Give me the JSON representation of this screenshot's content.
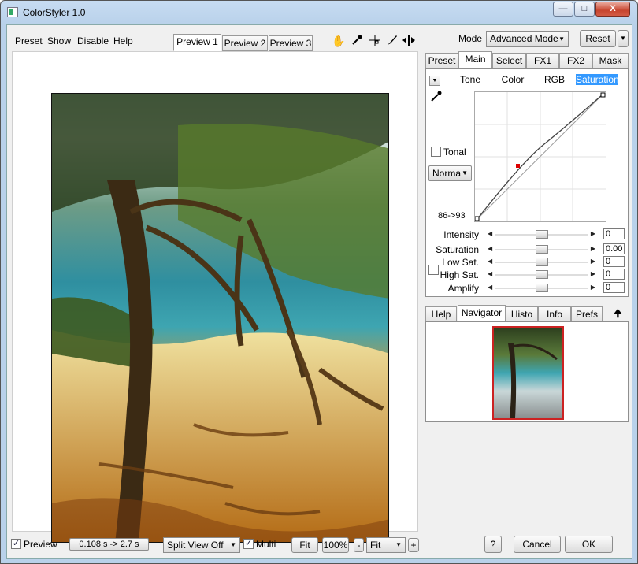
{
  "window": {
    "title": "ColorStyler 1.0",
    "min": "—",
    "max": "□",
    "close": "X"
  },
  "menu": [
    "Preset",
    "Show",
    "Disable",
    "Help"
  ],
  "preview_tabs": [
    {
      "label": "Preview 1",
      "active": true
    },
    {
      "label": "Preview 2",
      "active": false
    },
    {
      "label": "Preview 3",
      "active": false
    }
  ],
  "tools": [
    "hand-icon",
    "eyedropper-icon",
    "crosshair-icon",
    "brush-icon",
    "split-icon"
  ],
  "mode": {
    "label": "Mode",
    "value": "Advanced Mode",
    "reset": "Reset"
  },
  "right_tabs": [
    {
      "label": "Preset"
    },
    {
      "label": "Main",
      "active": true
    },
    {
      "label": "Select"
    },
    {
      "label": "FX1"
    },
    {
      "label": "FX2"
    },
    {
      "label": "Mask"
    }
  ],
  "curve_tabs": [
    {
      "label": "Tone"
    },
    {
      "label": "Color"
    },
    {
      "label": "RGB"
    },
    {
      "label": "Saturation",
      "active": true
    }
  ],
  "curve": {
    "tonal_label": "Tonal",
    "blend_mode": "Norma",
    "readout": "86->93",
    "accent": "#dd0000"
  },
  "sliders": [
    {
      "label": "Intensity",
      "value": "0",
      "level": 0.5
    },
    {
      "label": "Saturation",
      "value": "0.00",
      "level": 0.5
    },
    {
      "label": "Low Sat.",
      "value": "0",
      "level": 0.5
    },
    {
      "label": "High Sat.",
      "value": "0",
      "level": 0.5
    },
    {
      "label": "Amplify",
      "value": "0",
      "level": 0.5
    }
  ],
  "nav_tabs": [
    {
      "label": "Help"
    },
    {
      "label": "Navigator",
      "active": true
    },
    {
      "label": "Histo"
    },
    {
      "label": "Info"
    },
    {
      "label": "Prefs"
    }
  ],
  "bottom": {
    "preview_label": "Preview",
    "timing": "0.108 s -> 2.7 s",
    "split": "Split View Off",
    "multi_label": "Multi",
    "fit": "Fit",
    "zoom100": "100%",
    "minus": "-",
    "zoom_select": "Fit",
    "plus": "+",
    "help": "?",
    "cancel": "Cancel",
    "ok": "OK"
  }
}
